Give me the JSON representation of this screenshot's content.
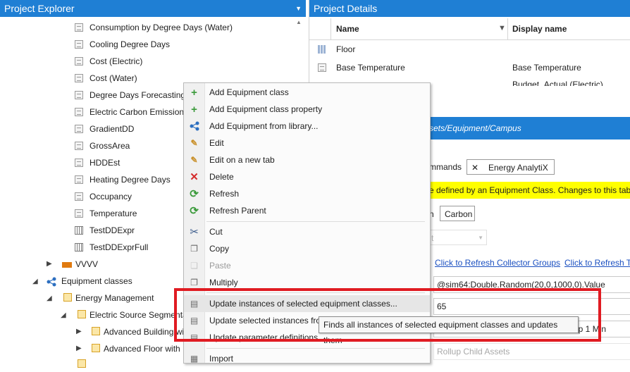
{
  "left_panel": {
    "title": "Project Explorer",
    "tree": [
      {
        "label": "Consumption by Degree Days (Water)",
        "icon": "doc-icon",
        "depth": 3
      },
      {
        "label": "Cooling Degree Days",
        "icon": "doc-icon",
        "depth": 3
      },
      {
        "label": "Cost (Electric)",
        "icon": "doc-icon",
        "depth": 3
      },
      {
        "label": "Cost (Water)",
        "icon": "doc-icon",
        "depth": 3
      },
      {
        "label": "Degree Days Forecasting",
        "icon": "doc-icon",
        "depth": 3
      },
      {
        "label": "Electric Carbon Emissions",
        "icon": "doc-icon",
        "depth": 3
      },
      {
        "label": "GradientDD",
        "icon": "doc-icon",
        "depth": 3
      },
      {
        "label": "GrossArea",
        "icon": "doc-icon",
        "depth": 3
      },
      {
        "label": "HDDEst",
        "icon": "doc-icon",
        "depth": 3
      },
      {
        "label": "Heating Degree Days",
        "icon": "doc-icon",
        "depth": 3
      },
      {
        "label": "Occupancy",
        "icon": "doc-icon",
        "depth": 3
      },
      {
        "label": "Temperature",
        "icon": "doc-icon",
        "depth": 3
      },
      {
        "label": "TestDDExpr",
        "icon": "grid-icon",
        "depth": 3
      },
      {
        "label": "TestDDExprFull",
        "icon": "grid-icon",
        "depth": 3
      },
      {
        "label": "VVVV",
        "icon": "factory-icon",
        "depth": 2,
        "expander": "collapsed"
      },
      {
        "label": "Equipment classes",
        "icon": "share-icon",
        "depth": 1,
        "expander": "expanded"
      },
      {
        "label": "Energy Management",
        "icon": "folder-icon",
        "depth": 2,
        "expander": "expanded"
      },
      {
        "label": "Electric Source Segmenta",
        "icon": "folder-icon",
        "depth": 3,
        "expander": "expanded"
      },
      {
        "label": "Advanced Building wi",
        "icon": "folder-icon",
        "depth": 4,
        "expander": "collapsed"
      },
      {
        "label": "Advanced Floor with I",
        "icon": "folder-icon",
        "depth": 4,
        "expander": "collapsed"
      }
    ]
  },
  "right_panel": {
    "title": "Project Details",
    "columns": {
      "name": "Name",
      "display_name": "Display name"
    },
    "rows": [
      {
        "name": "Floor",
        "display": ""
      },
      {
        "name": "Base Temperature",
        "display": "Base Temperature"
      },
      {
        "name": "",
        "display": "Budget_Actual (Electric)"
      }
    ],
    "path": "sets/Equipment/Campus",
    "tabs": {
      "commands": "mmands",
      "close": "✕",
      "analytix": "Energy AnalytiX"
    },
    "notice": "e defined by an Equipment Class. Changes to this tab",
    "subtabs": {
      "left": "n",
      "carbon": "Carbon"
    },
    "dropdown_value": "t",
    "links": {
      "refresh_collector": "Click to Refresh Collector Groups",
      "refresh_tr": "Click to Refresh Tr"
    },
    "fields": {
      "expression": "@sim64:Double.Random(20,0,1000,0).Value",
      "value": "65",
      "rollup": "up 1 Min",
      "rollup_child": "Rollup Child Assets"
    }
  },
  "context_menu": {
    "items": [
      {
        "label": "Add Equipment class",
        "icon": "plus-icon",
        "disabled": false
      },
      {
        "label": "Add Equipment class property",
        "icon": "plus-icon",
        "disabled": false
      },
      {
        "label": "Add Equipment from library...",
        "icon": "share-icon",
        "disabled": false
      },
      {
        "label": "Edit",
        "icon": "edit-icon",
        "disabled": false
      },
      {
        "label": "Edit on a new tab",
        "icon": "edit-tab-icon",
        "disabled": false
      },
      {
        "label": "Delete",
        "icon": "delete-icon",
        "disabled": false
      },
      {
        "label": "Refresh",
        "icon": "refresh-icon",
        "disabled": false
      },
      {
        "label": "Refresh Parent",
        "icon": "refresh-icon",
        "disabled": false
      },
      {
        "label": "Cut",
        "icon": "scissors-icon",
        "disabled": false
      },
      {
        "label": "Copy",
        "icon": "copy-icon",
        "disabled": false
      },
      {
        "label": "Paste",
        "icon": "paste-icon",
        "disabled": true
      },
      {
        "label": "Multiply",
        "icon": "multiply-icon",
        "disabled": false
      },
      {
        "label": "Update instances of selected equipment classes...",
        "icon": "update-icon",
        "disabled": false,
        "highlighted": true
      },
      {
        "label": "Update selected instances fro",
        "icon": "update-icon",
        "disabled": false
      },
      {
        "label": "Update parameter definitions",
        "icon": "update-icon",
        "disabled": false
      },
      {
        "label": "Import",
        "icon": "import-icon",
        "disabled": false
      }
    ]
  },
  "tooltip": {
    "text": "Finds all instances of selected equipment classes and updates them"
  },
  "colors": {
    "header_blue": "#1f7fd4",
    "highlight_yellow": "#ffff00",
    "annotation_red": "#e01b22",
    "plus_green": "#3a9a3a",
    "delete_red": "#d42b2b"
  }
}
